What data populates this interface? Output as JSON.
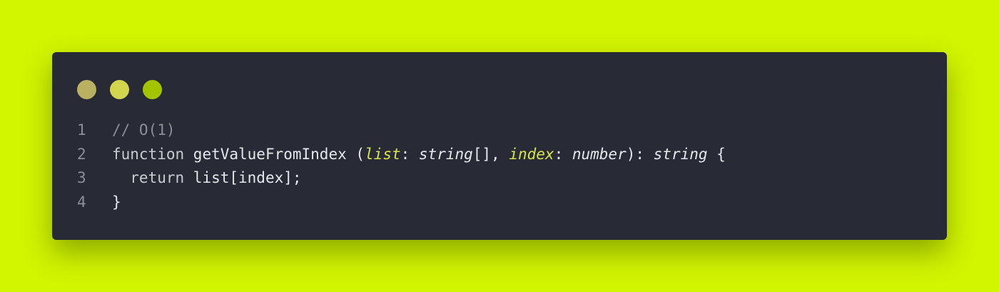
{
  "colors": {
    "background": "#d2f500",
    "window": "#282b36",
    "line_number": "#8d8f95",
    "comment": "#8d8f95",
    "keyword": "#c9cbd0",
    "text": "#e6e7ea",
    "param": "#d8e34a",
    "type": "#e6e7ea"
  },
  "window_controls": [
    {
      "name": "close-dot",
      "color": "#b9b062"
    },
    {
      "name": "minimize-dot",
      "color": "#d1d64e"
    },
    {
      "name": "maximize-dot",
      "color": "#a3c400"
    }
  ],
  "code": {
    "lines": [
      {
        "number": "1",
        "tokens": [
          {
            "text": "// O(1)",
            "kind": "comment"
          }
        ]
      },
      {
        "number": "2",
        "tokens": [
          {
            "text": "function",
            "kind": "keyword"
          },
          {
            "text": " getValueFromIndex (",
            "kind": "text"
          },
          {
            "text": "list",
            "kind": "param"
          },
          {
            "text": ": ",
            "kind": "text"
          },
          {
            "text": "string",
            "kind": "type"
          },
          {
            "text": "[], ",
            "kind": "text"
          },
          {
            "text": "index",
            "kind": "param"
          },
          {
            "text": ": ",
            "kind": "text"
          },
          {
            "text": "number",
            "kind": "type"
          },
          {
            "text": "): ",
            "kind": "text"
          },
          {
            "text": "string",
            "kind": "type"
          },
          {
            "text": " {",
            "kind": "text"
          }
        ]
      },
      {
        "number": "3",
        "tokens": [
          {
            "text": "  return",
            "kind": "keyword"
          },
          {
            "text": " list[index];",
            "kind": "text"
          }
        ]
      },
      {
        "number": "4",
        "tokens": [
          {
            "text": "}",
            "kind": "text"
          }
        ]
      }
    ]
  }
}
